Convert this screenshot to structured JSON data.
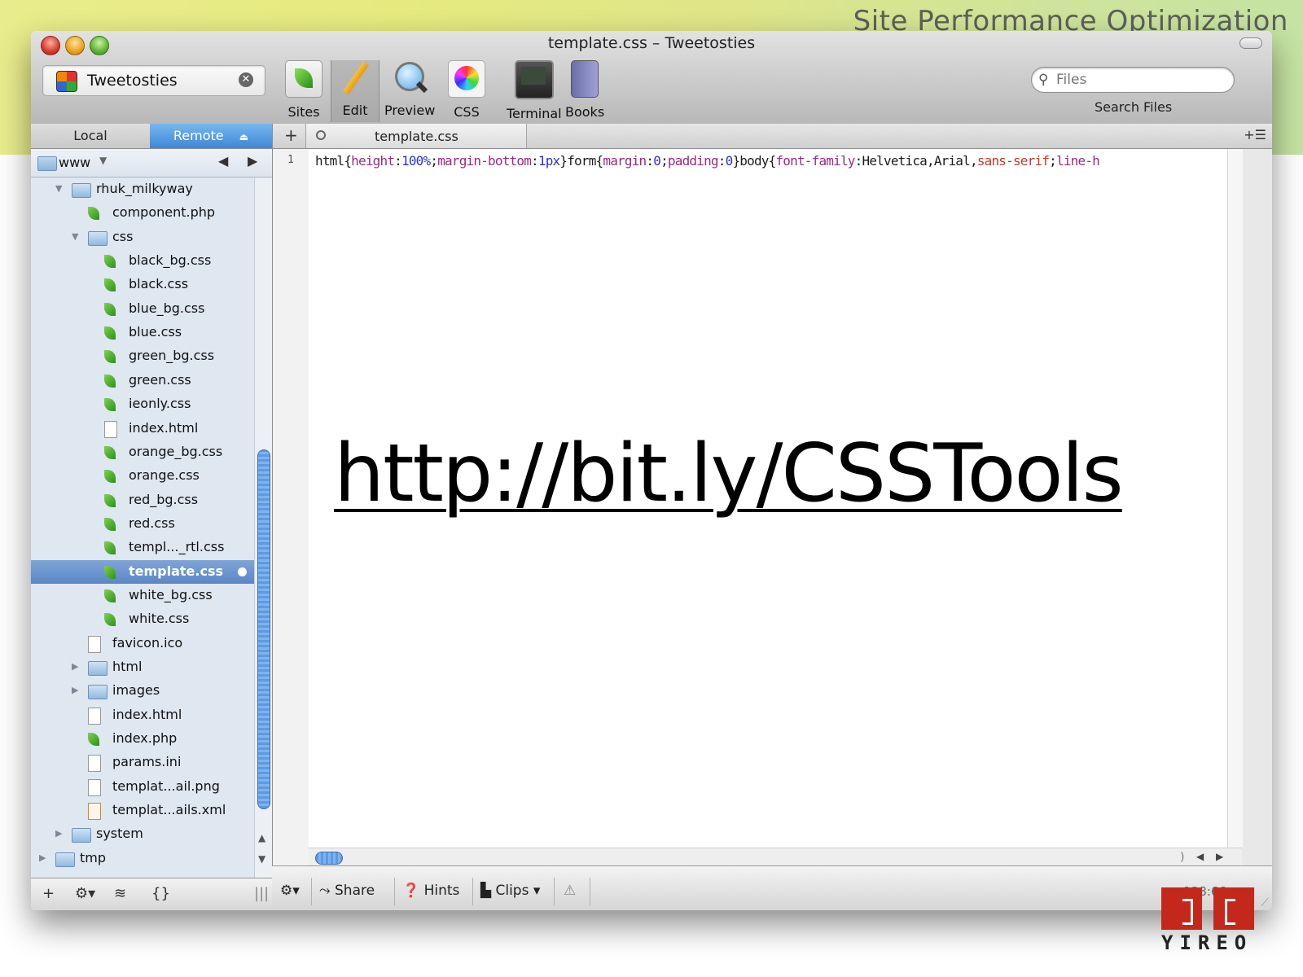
{
  "slide": {
    "title": "Site Performance Optimization"
  },
  "window": {
    "title": "template.css – Tweetosties"
  },
  "site_selector": {
    "name": "Tweetosties"
  },
  "toolbar": {
    "items": [
      {
        "label": "Sites",
        "icon": "sites-leaf-icon"
      },
      {
        "label": "Edit",
        "icon": "pencil-icon"
      },
      {
        "label": "Preview",
        "icon": "magnifier-icon"
      },
      {
        "label": "CSS",
        "icon": "color-wheel-icon"
      },
      {
        "label": "Terminal",
        "icon": "terminal-icon"
      },
      {
        "label": "Books",
        "icon": "book-icon"
      }
    ],
    "search_placeholder": "Files",
    "search_label": "Search Files"
  },
  "sidebar": {
    "tab_local": "Local",
    "tab_remote": "Remote",
    "path": "www",
    "tree": [
      {
        "name": "rhuk_milkyway",
        "type": "folder",
        "depth": 1,
        "open": true
      },
      {
        "name": "component.php",
        "type": "leaf",
        "depth": 2
      },
      {
        "name": "css",
        "type": "folder",
        "depth": 2,
        "open": true
      },
      {
        "name": "black_bg.css",
        "type": "leaf",
        "depth": 3
      },
      {
        "name": "black.css",
        "type": "leaf",
        "depth": 3
      },
      {
        "name": "blue_bg.css",
        "type": "leaf",
        "depth": 3
      },
      {
        "name": "blue.css",
        "type": "leaf",
        "depth": 3
      },
      {
        "name": "green_bg.css",
        "type": "leaf",
        "depth": 3
      },
      {
        "name": "green.css",
        "type": "leaf",
        "depth": 3
      },
      {
        "name": "ieonly.css",
        "type": "leaf",
        "depth": 3
      },
      {
        "name": "index.html",
        "type": "doc",
        "depth": 3
      },
      {
        "name": "orange_bg.css",
        "type": "leaf",
        "depth": 3
      },
      {
        "name": "orange.css",
        "type": "leaf",
        "depth": 3
      },
      {
        "name": "red_bg.css",
        "type": "leaf",
        "depth": 3
      },
      {
        "name": "red.css",
        "type": "leaf",
        "depth": 3
      },
      {
        "name": "templ..._rtl.css",
        "type": "leaf",
        "depth": 3
      },
      {
        "name": "template.css",
        "type": "leaf",
        "depth": 3,
        "selected": true
      },
      {
        "name": "white_bg.css",
        "type": "leaf",
        "depth": 3
      },
      {
        "name": "white.css",
        "type": "leaf",
        "depth": 3
      },
      {
        "name": "favicon.ico",
        "type": "doc",
        "depth": 2
      },
      {
        "name": "html",
        "type": "folder",
        "depth": 2,
        "open": false
      },
      {
        "name": "images",
        "type": "folder",
        "depth": 2,
        "open": false
      },
      {
        "name": "index.html",
        "type": "doc",
        "depth": 2
      },
      {
        "name": "index.php",
        "type": "leaf",
        "depth": 2
      },
      {
        "name": "params.ini",
        "type": "doc",
        "depth": 2
      },
      {
        "name": "templat...ail.png",
        "type": "doc",
        "depth": 2
      },
      {
        "name": "templat...ails.xml",
        "type": "xml",
        "depth": 2
      },
      {
        "name": "system",
        "type": "folder",
        "depth": 1,
        "open": false
      },
      {
        "name": "tmp",
        "type": "folder",
        "depth": 0,
        "open": false
      }
    ]
  },
  "editor": {
    "tab_name": "template.css",
    "line_number": "1",
    "code_tokens": [
      {
        "t": "html{",
        "c": "sel"
      },
      {
        "t": "height",
        "c": "prop"
      },
      {
        "t": ":",
        "c": "pun"
      },
      {
        "t": "100%",
        "c": "val"
      },
      {
        "t": ";",
        "c": "pun"
      },
      {
        "t": "margin-bottom",
        "c": "prop"
      },
      {
        "t": ":",
        "c": "pun"
      },
      {
        "t": "1px",
        "c": "val"
      },
      {
        "t": "}",
        "c": "pun"
      },
      {
        "t": "form{",
        "c": "sel"
      },
      {
        "t": "margin",
        "c": "prop"
      },
      {
        "t": ":",
        "c": "pun"
      },
      {
        "t": "0",
        "c": "val"
      },
      {
        "t": ";",
        "c": "pun"
      },
      {
        "t": "padding",
        "c": "prop"
      },
      {
        "t": ":",
        "c": "pun"
      },
      {
        "t": "0",
        "c": "val"
      },
      {
        "t": "}",
        "c": "pun"
      },
      {
        "t": "body{",
        "c": "sel"
      },
      {
        "t": "font-family",
        "c": "prop"
      },
      {
        "t": ":",
        "c": "pun"
      },
      {
        "t": "Helvetica,Arial,",
        "c": "sel"
      },
      {
        "t": "sans-serif",
        "c": "str"
      },
      {
        "t": ";",
        "c": "pun"
      },
      {
        "t": "line-h",
        "c": "prop"
      }
    ],
    "overlay_link": "http://bit.ly/CSSTools",
    "cursor_position": "128:66"
  },
  "footer": {
    "share": "Share",
    "hints": "Hints",
    "clips": "Clips"
  },
  "logo": {
    "text": "YIREO"
  }
}
